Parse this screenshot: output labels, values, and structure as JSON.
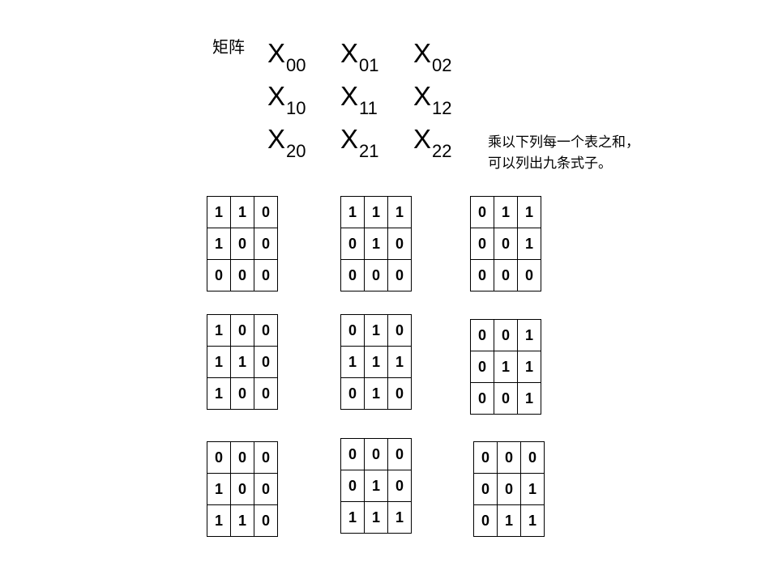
{
  "label": "矩阵",
  "variables": [
    [
      {
        "base": "X",
        "sub": "00"
      },
      {
        "base": "X",
        "sub": "01"
      },
      {
        "base": "X",
        "sub": "02"
      }
    ],
    [
      {
        "base": "X",
        "sub": "10"
      },
      {
        "base": "X",
        "sub": "11"
      },
      {
        "base": "X",
        "sub": "12"
      }
    ],
    [
      {
        "base": "X",
        "sub": "20"
      },
      {
        "base": "X",
        "sub": "21"
      },
      {
        "base": "X",
        "sub": "22"
      }
    ]
  ],
  "note": {
    "line1": "乘以下列每一个表之和，",
    "line2": "可以列出九条式子。"
  },
  "tables": [
    [
      [
        "1",
        "1",
        "0"
      ],
      [
        "1",
        "0",
        "0"
      ],
      [
        "0",
        "0",
        "0"
      ]
    ],
    [
      [
        "1",
        "1",
        "1"
      ],
      [
        "0",
        "1",
        "0"
      ],
      [
        "0",
        "0",
        "0"
      ]
    ],
    [
      [
        "0",
        "1",
        "1"
      ],
      [
        "0",
        "0",
        "1"
      ],
      [
        "0",
        "0",
        "0"
      ]
    ],
    [
      [
        "1",
        "0",
        "0"
      ],
      [
        "1",
        "1",
        "0"
      ],
      [
        "1",
        "0",
        "0"
      ]
    ],
    [
      [
        "0",
        "1",
        "0"
      ],
      [
        "1",
        "1",
        "1"
      ],
      [
        "0",
        "1",
        "0"
      ]
    ],
    [
      [
        "0",
        "0",
        "1"
      ],
      [
        "0",
        "1",
        "1"
      ],
      [
        "0",
        "0",
        "1"
      ]
    ],
    [
      [
        "0",
        "0",
        "0"
      ],
      [
        "1",
        "0",
        "0"
      ],
      [
        "1",
        "1",
        "0"
      ]
    ],
    [
      [
        "0",
        "0",
        "0"
      ],
      [
        "0",
        "1",
        "0"
      ],
      [
        "1",
        "1",
        "1"
      ]
    ],
    [
      [
        "0",
        "0",
        "0"
      ],
      [
        "0",
        "0",
        "1"
      ],
      [
        "0",
        "1",
        "1"
      ]
    ]
  ]
}
